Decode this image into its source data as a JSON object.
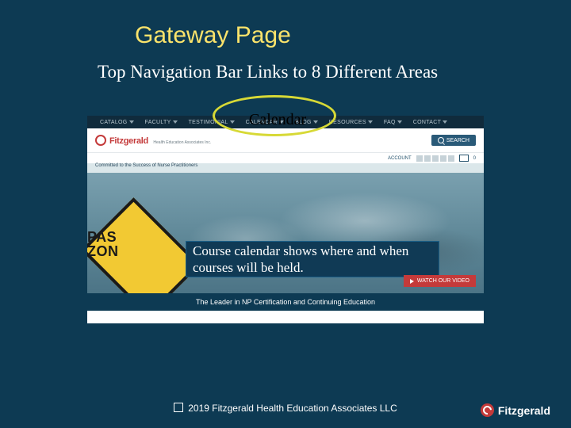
{
  "slide": {
    "title": "Gateway Page",
    "subtitle": "Top Navigation Bar Links to 8 Different Areas",
    "callout_label": "Calendar",
    "description": "Course calendar shows where and when courses will be held."
  },
  "screenshot": {
    "nav": {
      "items": [
        "CATALOG",
        "FACULTY",
        "TESTIMONIAL",
        "CALENDAR",
        "BLOG",
        "RESOURCES",
        "FAQ",
        "CONTACT"
      ]
    },
    "brand": {
      "name": "Fitzgerald",
      "sub": "Health Education Associates Inc."
    },
    "search_label": "SEARCH",
    "account_label": "ACCOUNT",
    "cart_count": "0",
    "tagline": "Committed to the Success of Nurse Practitioners",
    "sign_line1": "PAS",
    "sign_line2": "ZON",
    "watch_label": "WATCH OUR VIDEO",
    "bluebar": "The Leader in NP Certification and Continuing Education"
  },
  "footer": {
    "copyright": "2019 Fitzgerald Health Education Associates LLC",
    "corner_brand": "Fitzgerald"
  }
}
